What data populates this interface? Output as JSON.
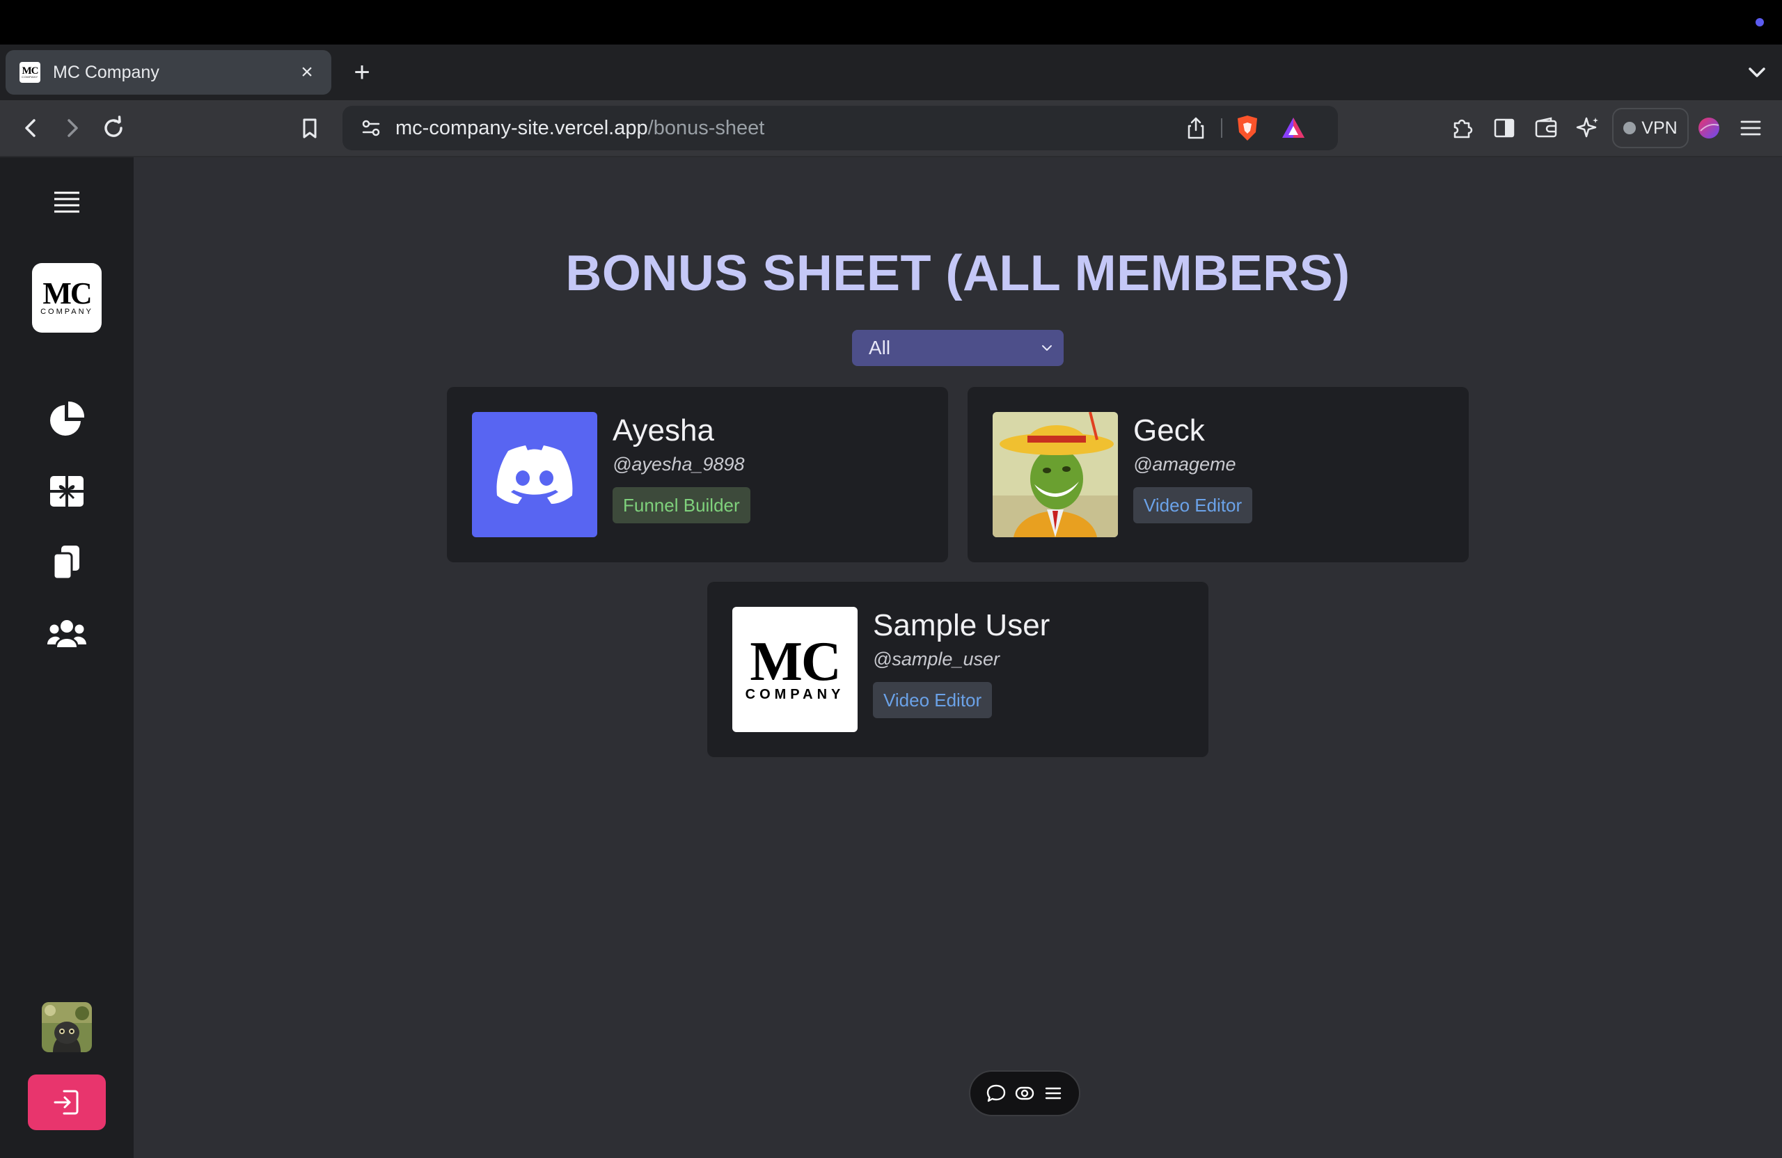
{
  "browser": {
    "tab": {
      "title": "MC Company"
    },
    "omnibox": {
      "domain": "mc-company-site.vercel.app",
      "path": "/bonus-sheet"
    },
    "vpn_label": "VPN"
  },
  "logo": {
    "mc": "MC",
    "company": "COMPANY"
  },
  "sidebar": {
    "items": [
      {
        "name": "menu",
        "icon": "hamburger-icon"
      },
      {
        "name": "logo",
        "icon": "mc-company-logo"
      },
      {
        "name": "dashboard",
        "icon": "pie-chart-icon"
      },
      {
        "name": "bonus",
        "icon": "gift-icon"
      },
      {
        "name": "documents",
        "icon": "copy-icon"
      },
      {
        "name": "members",
        "icon": "users-icon"
      }
    ]
  },
  "page": {
    "title": "BONUS SHEET (ALL MEMBERS)",
    "filter": {
      "selected": "All"
    }
  },
  "members": [
    {
      "name": "Ayesha",
      "handle": "@ayesha_9898",
      "role": "Funnel Builder",
      "role_color": "#7fd17c",
      "avatar": "discord-logo"
    },
    {
      "name": "Geck",
      "handle": "@amageme",
      "role": "Video Editor",
      "role_color": "#6ba2e8",
      "avatar": "photo"
    },
    {
      "name": "Sample User",
      "handle": "@sample_user",
      "role": "Video Editor",
      "role_color": "#6ba2e8",
      "avatar": "mc-company-logo"
    }
  ],
  "colors": {
    "accent": "#c5c8f7",
    "select": "#4d4f8a",
    "discord": "#5865f2",
    "login": "#e8356d"
  }
}
